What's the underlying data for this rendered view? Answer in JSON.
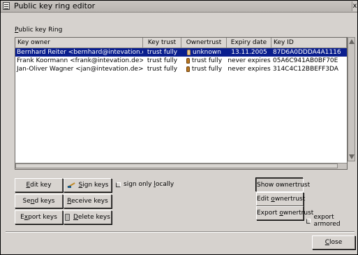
{
  "window": {
    "title": "Public key ring editor",
    "close_glyph": "x"
  },
  "group": {
    "label_prefix": "P",
    "label_rest": "ublic key Ring"
  },
  "table": {
    "headers": [
      "Key owner",
      "Key trust",
      "Ownertrust",
      "Expiry date",
      "Key ID"
    ],
    "rows": [
      {
        "owner": "Bernhard Reiter <bernhard@intevation.de>",
        "key_trust": "trust fully",
        "ownertrust": "unknown",
        "expiry": "13.11.2005",
        "key_id": "87D6A0DDDA4A1116",
        "selected": true
      },
      {
        "owner": "Frank Koormann <frank@intevation.de>",
        "key_trust": "trust fully",
        "ownertrust": "trust fully",
        "expiry": "never expires",
        "key_id": "05A6C941AB0BF70E",
        "selected": false
      },
      {
        "owner": "Jan-Oliver Wagner <jan@intevation.de>",
        "key_trust": "trust fully",
        "ownertrust": "trust fully",
        "expiry": "never expires",
        "key_id": "314C4C12BBEFF3DA",
        "selected": false
      }
    ]
  },
  "buttons": {
    "edit_key": {
      "u": "E",
      "rest": "dit key"
    },
    "sign_keys": {
      "u": "S",
      "rest": "ign keys"
    },
    "send_keys_pre": "Se",
    "send_keys_u": "n",
    "send_keys_post": "d keys",
    "receive_keys_u": "R",
    "receive_keys_rest": "eceive keys",
    "export_keys_pre": "E",
    "export_keys_u": "x",
    "export_keys_post": "port keys",
    "delete_keys_u": "D",
    "delete_keys_rest": "elete keys",
    "show_ownertrust": "Show ownertrust",
    "edit_ownertrust_pre": "Edit ",
    "edit_ownertrust_u": "o",
    "edit_ownertrust_post": "wnertrust",
    "export_ownertrust_pre": "Export ",
    "export_ownertrust_u": "o",
    "export_ownertrust_post": "wnertrust",
    "close_u": "C",
    "close_rest": "lose"
  },
  "options": {
    "sign_only_locally_pre": "sign only ",
    "sign_only_locally_u": "l",
    "sign_only_locally_post": "ocally",
    "export_armored": "export armored"
  }
}
